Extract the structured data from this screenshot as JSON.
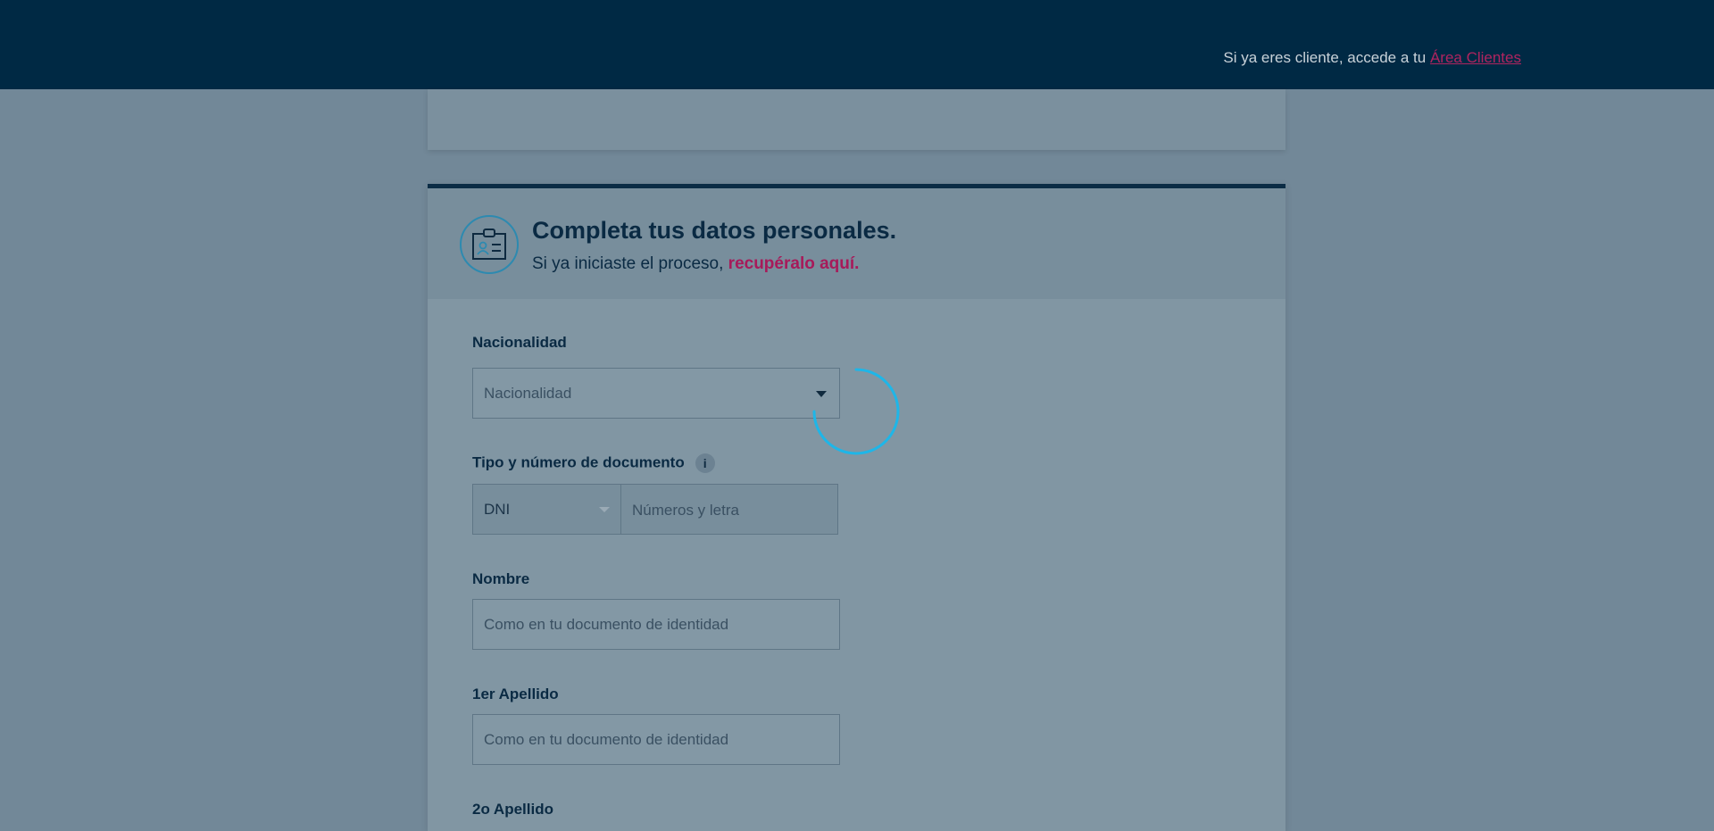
{
  "header": {
    "login_prompt": "Si ya eres cliente, accede a tu ",
    "login_link": "Área Clientes"
  },
  "form": {
    "title": "Completa tus datos personales.",
    "subtitle": "Si ya iniciaste el proceso, ",
    "recover_link": "recupéralo aquí.",
    "icon": "id-card-icon"
  },
  "fields": {
    "nationality": {
      "label": "Nacionalidad",
      "placeholder": "Nacionalidad"
    },
    "document": {
      "label": "Tipo y número de documento",
      "info": "i",
      "type_value": "DNI",
      "number_placeholder": "Números y letra"
    },
    "first_name": {
      "label": "Nombre",
      "placeholder": "Como en tu documento de identidad"
    },
    "surname1": {
      "label": "1er Apellido",
      "placeholder": "Como en tu documento de identidad"
    },
    "surname2": {
      "label": "2o Apellido"
    }
  },
  "colors": {
    "header_bg": "#002944",
    "accent": "#a71a5a",
    "spinner": "#1eb6e8",
    "overlay": "#728898"
  }
}
